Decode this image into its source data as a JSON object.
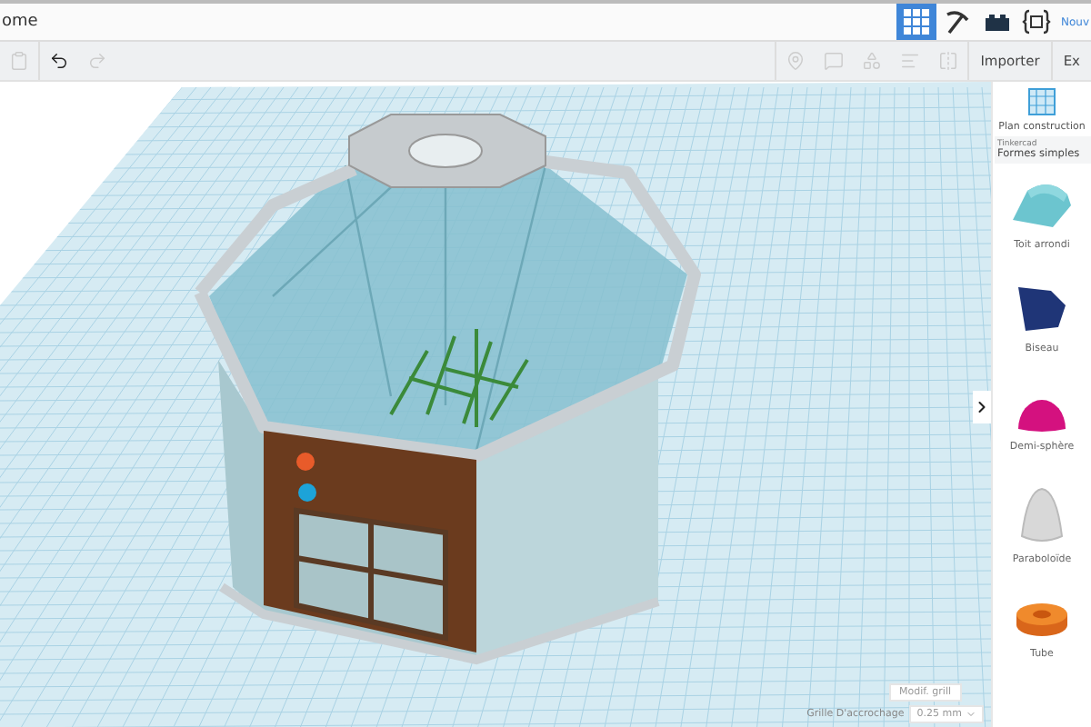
{
  "top_bar": {
    "title": "ome",
    "views": [
      {
        "kind": "grid",
        "selected": true
      },
      {
        "kind": "pickaxe",
        "selected": false
      },
      {
        "kind": "brick",
        "selected": false
      },
      {
        "kind": "code",
        "selected": false
      }
    ],
    "new_label": "Nouv"
  },
  "toolbar": {
    "left_tools": [
      {
        "kind": "paste",
        "disabled": true
      },
      {
        "kind": "undo",
        "disabled": false
      },
      {
        "kind": "redo",
        "disabled": true
      }
    ],
    "right_tools": [
      {
        "kind": "pin",
        "disabled": true
      },
      {
        "kind": "note",
        "disabled": true
      },
      {
        "kind": "shape",
        "disabled": true
      },
      {
        "kind": "align",
        "disabled": true
      },
      {
        "kind": "mirror",
        "disabled": true
      }
    ],
    "buttons": [
      "Importer",
      "Ex"
    ]
  },
  "sidebar": {
    "plan_label": "Plan construction",
    "library_caption": "Tinkercad",
    "library": "Formes simples",
    "shapes": [
      {
        "kind": "roof",
        "label": "Toit arrondi"
      },
      {
        "kind": "wedge",
        "label": "Biseau"
      },
      {
        "kind": "half_sphere",
        "label": "Demi-sphère"
      },
      {
        "kind": "paraboloid",
        "label": "Paraboloïde"
      },
      {
        "kind": "tube",
        "label": "Tube"
      }
    ]
  },
  "grid_controls": {
    "edit_grid": "Modif. grill",
    "snap_label": "Grille D'accrochage",
    "snap_value": "0.25 mm"
  }
}
